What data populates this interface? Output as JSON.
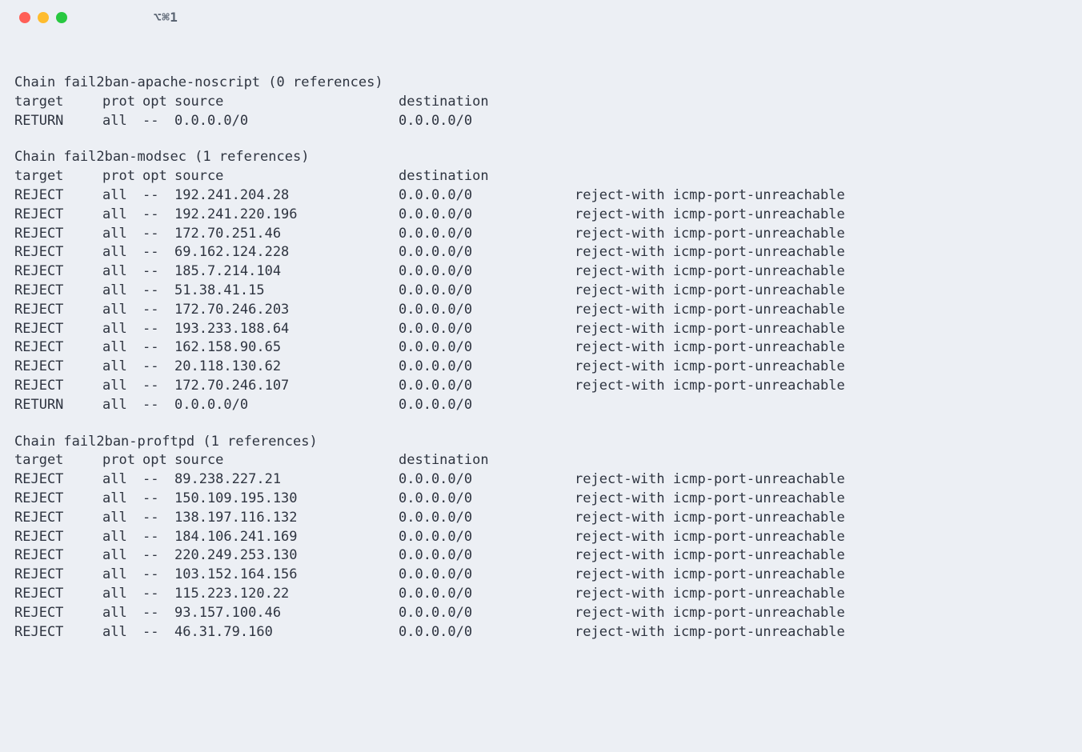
{
  "titlebar": {
    "tab_label": "⌥⌘1"
  },
  "headers": {
    "target": "target",
    "prot": "prot",
    "opt": "opt",
    "source": "source",
    "destination": "destination"
  },
  "chains": [
    {
      "title": "Chain fail2ban-apache-noscript (0 references)",
      "rules": [
        {
          "target": "RETURN",
          "prot": "all",
          "opt": "--",
          "source": "0.0.0.0/0",
          "destination": "0.0.0.0/0",
          "extra": ""
        }
      ]
    },
    {
      "title": "Chain fail2ban-modsec (1 references)",
      "rules": [
        {
          "target": "REJECT",
          "prot": "all",
          "opt": "--",
          "source": "192.241.204.28",
          "destination": "0.0.0.0/0",
          "extra": "reject-with icmp-port-unreachable"
        },
        {
          "target": "REJECT",
          "prot": "all",
          "opt": "--",
          "source": "192.241.220.196",
          "destination": "0.0.0.0/0",
          "extra": "reject-with icmp-port-unreachable"
        },
        {
          "target": "REJECT",
          "prot": "all",
          "opt": "--",
          "source": "172.70.251.46",
          "destination": "0.0.0.0/0",
          "extra": "reject-with icmp-port-unreachable"
        },
        {
          "target": "REJECT",
          "prot": "all",
          "opt": "--",
          "source": "69.162.124.228",
          "destination": "0.0.0.0/0",
          "extra": "reject-with icmp-port-unreachable"
        },
        {
          "target": "REJECT",
          "prot": "all",
          "opt": "--",
          "source": "185.7.214.104",
          "destination": "0.0.0.0/0",
          "extra": "reject-with icmp-port-unreachable"
        },
        {
          "target": "REJECT",
          "prot": "all",
          "opt": "--",
          "source": "51.38.41.15",
          "destination": "0.0.0.0/0",
          "extra": "reject-with icmp-port-unreachable"
        },
        {
          "target": "REJECT",
          "prot": "all",
          "opt": "--",
          "source": "172.70.246.203",
          "destination": "0.0.0.0/0",
          "extra": "reject-with icmp-port-unreachable"
        },
        {
          "target": "REJECT",
          "prot": "all",
          "opt": "--",
          "source": "193.233.188.64",
          "destination": "0.0.0.0/0",
          "extra": "reject-with icmp-port-unreachable"
        },
        {
          "target": "REJECT",
          "prot": "all",
          "opt": "--",
          "source": "162.158.90.65",
          "destination": "0.0.0.0/0",
          "extra": "reject-with icmp-port-unreachable"
        },
        {
          "target": "REJECT",
          "prot": "all",
          "opt": "--",
          "source": "20.118.130.62",
          "destination": "0.0.0.0/0",
          "extra": "reject-with icmp-port-unreachable"
        },
        {
          "target": "REJECT",
          "prot": "all",
          "opt": "--",
          "source": "172.70.246.107",
          "destination": "0.0.0.0/0",
          "extra": "reject-with icmp-port-unreachable"
        },
        {
          "target": "RETURN",
          "prot": "all",
          "opt": "--",
          "source": "0.0.0.0/0",
          "destination": "0.0.0.0/0",
          "extra": ""
        }
      ]
    },
    {
      "title": "Chain fail2ban-proftpd (1 references)",
      "rules": [
        {
          "target": "REJECT",
          "prot": "all",
          "opt": "--",
          "source": "89.238.227.21",
          "destination": "0.0.0.0/0",
          "extra": "reject-with icmp-port-unreachable"
        },
        {
          "target": "REJECT",
          "prot": "all",
          "opt": "--",
          "source": "150.109.195.130",
          "destination": "0.0.0.0/0",
          "extra": "reject-with icmp-port-unreachable"
        },
        {
          "target": "REJECT",
          "prot": "all",
          "opt": "--",
          "source": "138.197.116.132",
          "destination": "0.0.0.0/0",
          "extra": "reject-with icmp-port-unreachable"
        },
        {
          "target": "REJECT",
          "prot": "all",
          "opt": "--",
          "source": "184.106.241.169",
          "destination": "0.0.0.0/0",
          "extra": "reject-with icmp-port-unreachable"
        },
        {
          "target": "REJECT",
          "prot": "all",
          "opt": "--",
          "source": "220.249.253.130",
          "destination": "0.0.0.0/0",
          "extra": "reject-with icmp-port-unreachable"
        },
        {
          "target": "REJECT",
          "prot": "all",
          "opt": "--",
          "source": "103.152.164.156",
          "destination": "0.0.0.0/0",
          "extra": "reject-with icmp-port-unreachable"
        },
        {
          "target": "REJECT",
          "prot": "all",
          "opt": "--",
          "source": "115.223.120.22",
          "destination": "0.0.0.0/0",
          "extra": "reject-with icmp-port-unreachable"
        },
        {
          "target": "REJECT",
          "prot": "all",
          "opt": "--",
          "source": "93.157.100.46",
          "destination": "0.0.0.0/0",
          "extra": "reject-with icmp-port-unreachable"
        },
        {
          "target": "REJECT",
          "prot": "all",
          "opt": "--",
          "source": "46.31.79.160",
          "destination": "0.0.0.0/0",
          "extra": "reject-with icmp-port-unreachable"
        }
      ]
    }
  ]
}
